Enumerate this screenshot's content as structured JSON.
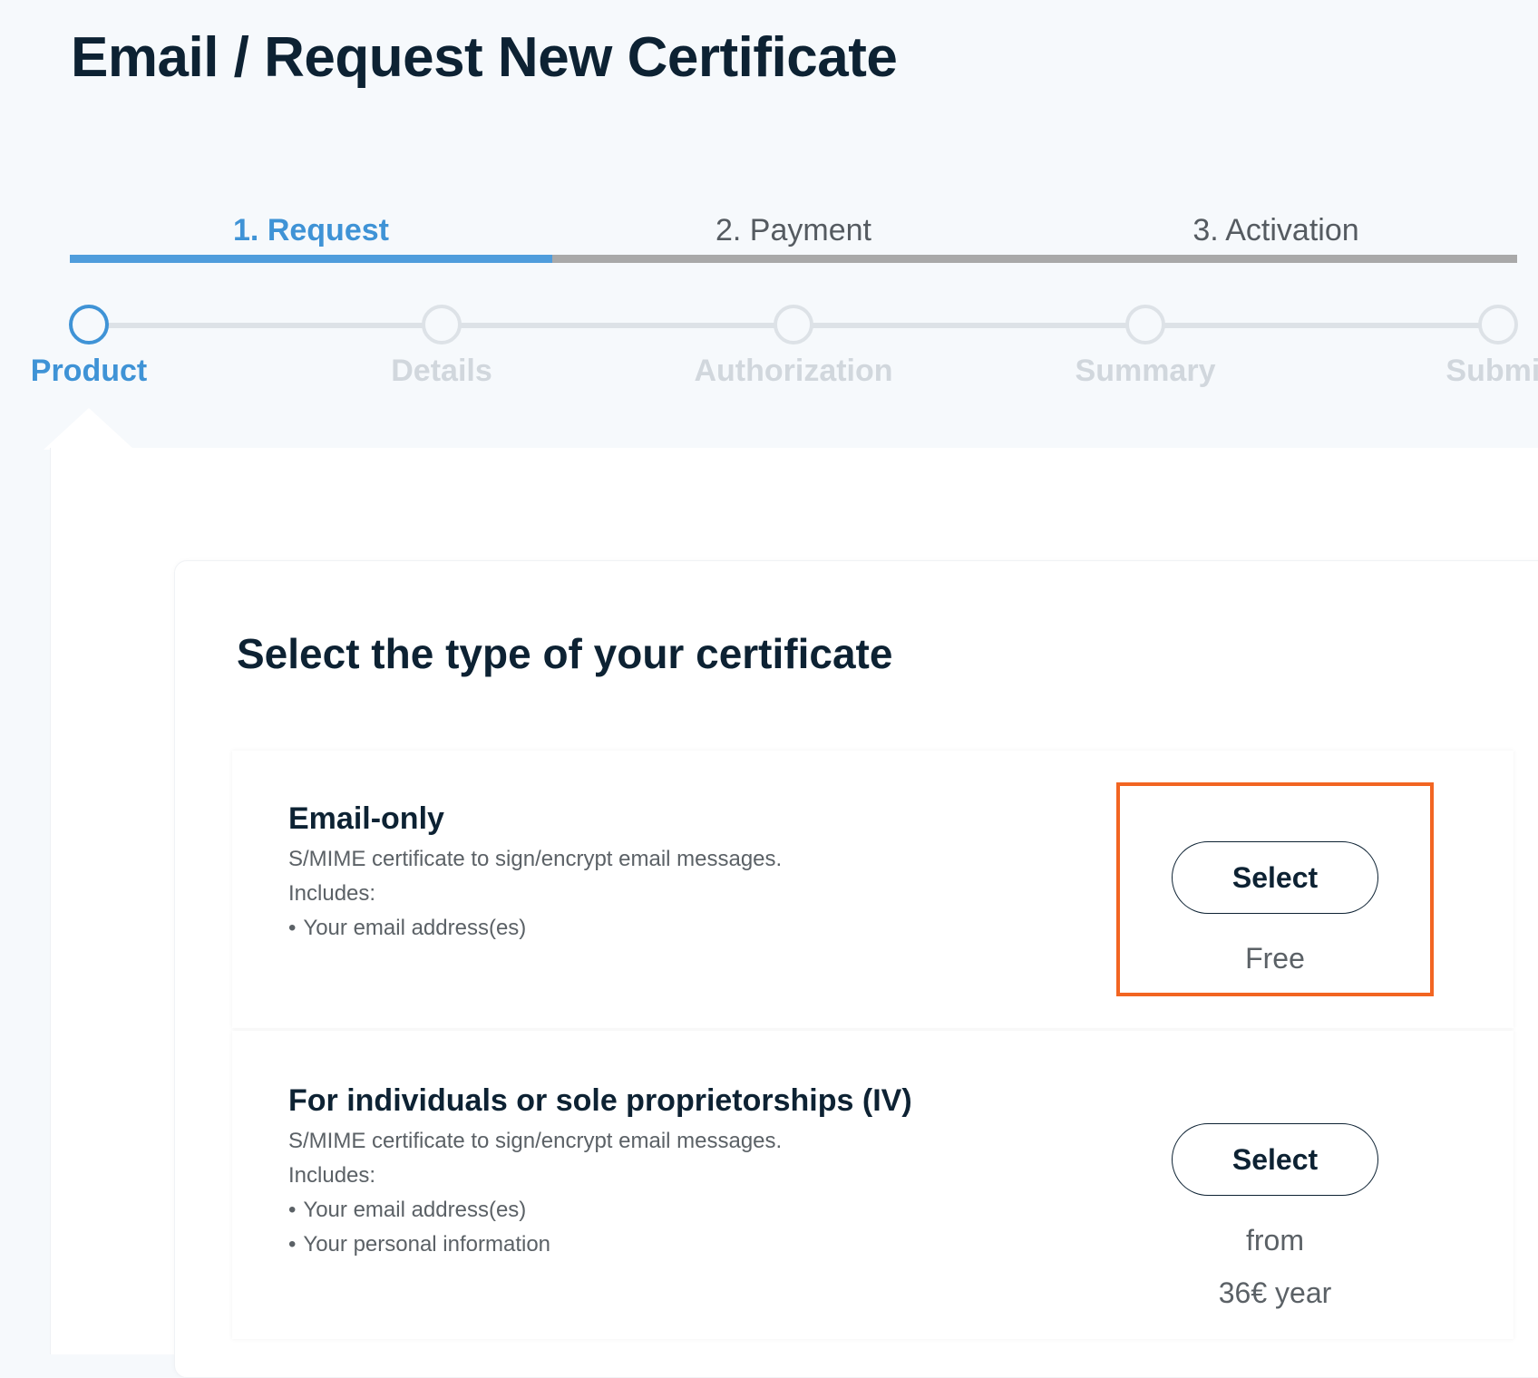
{
  "page": {
    "title": "Email / Request New Certificate"
  },
  "phases": [
    {
      "label": "1. Request",
      "active": true
    },
    {
      "label": "2. Payment",
      "active": false
    },
    {
      "label": "3. Activation",
      "active": false
    }
  ],
  "steps": [
    {
      "label": "Product",
      "active": true
    },
    {
      "label": "Details",
      "active": false
    },
    {
      "label": "Authorization",
      "active": false
    },
    {
      "label": "Summary",
      "active": false
    },
    {
      "label": "Submit",
      "active": false
    }
  ],
  "main": {
    "section_title": "Select the type of your certificate",
    "options": [
      {
        "title": "Email-only",
        "description": "S/MIME certificate to sign/encrypt email messages.",
        "includes_label": "Includes:",
        "includes": [
          "Your email address(es)"
        ],
        "button_label": "Select",
        "price_line1": "Free",
        "highlighted": true
      },
      {
        "title": "For individuals or sole proprietorships (IV)",
        "description": "S/MIME certificate to sign/encrypt email messages.",
        "includes_label": "Includes:",
        "includes": [
          "Your email address(es)",
          "Your personal information"
        ],
        "button_label": "Select",
        "price_line1": "from",
        "price_line2": "36€ year"
      }
    ]
  },
  "colors": {
    "accent": "#3f93d6",
    "highlight": "#f26522",
    "text_dark": "#0d2233",
    "inactive_step": "#d1d7dd",
    "background": "#f6f9fc"
  }
}
